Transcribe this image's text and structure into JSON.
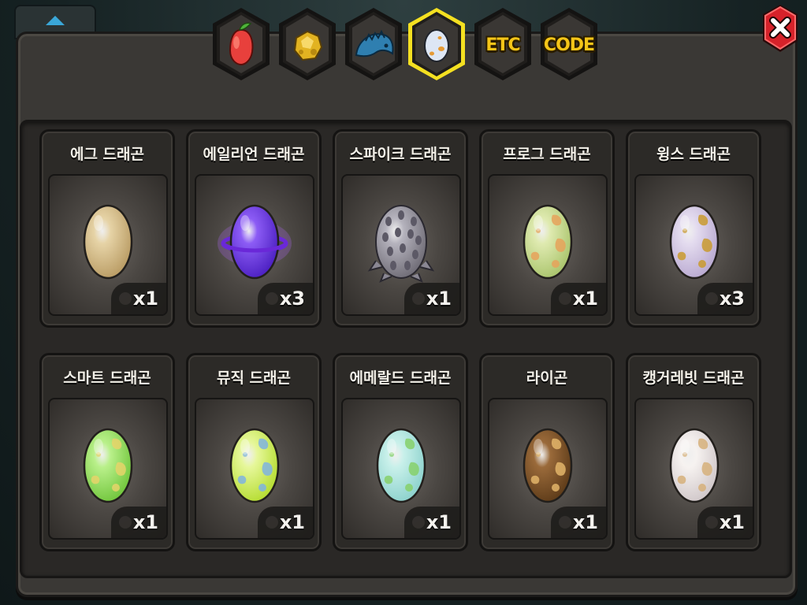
{
  "tabs": [
    {
      "id": "fruit",
      "icon": "red-fruit-icon",
      "label": "",
      "active": false
    },
    {
      "id": "gold",
      "icon": "gold-nugget-icon",
      "label": "",
      "active": false
    },
    {
      "id": "fossil",
      "icon": "blue-dragon-head-icon",
      "label": "",
      "active": false
    },
    {
      "id": "egg",
      "icon": "egg-icon",
      "label": "",
      "active": true
    },
    {
      "id": "etc",
      "icon": "",
      "label": "ETC",
      "active": false
    },
    {
      "id": "code",
      "icon": "",
      "label": "CODE",
      "active": false
    }
  ],
  "colors": {
    "active_tab_border": "#f4e021",
    "tab_face": "#3a3734",
    "label_yellow": "#f5c518",
    "close_red": "#d6222a"
  },
  "items": [
    {
      "name": "에그 드래곤",
      "qty": "x1",
      "egg": {
        "base": "#e6d3a6",
        "dark": "#b89a62",
        "spots": "none"
      }
    },
    {
      "name": "에일리언 드래곤",
      "qty": "x3",
      "egg": {
        "base": "#8c5cf5",
        "dark": "#4a1ec0",
        "spots": "ring"
      }
    },
    {
      "name": "스파이크 드래곤",
      "qty": "x1",
      "egg": {
        "base": "#b5b3bd",
        "dark": "#6d6a74",
        "spots": "spikes"
      }
    },
    {
      "name": "프로그 드래곤",
      "qty": "x1",
      "egg": {
        "base": "#dfeab0",
        "dark": "#a8c36a",
        "spots": "#e6a25a"
      }
    },
    {
      "name": "윙스 드래곤",
      "qty": "x3",
      "egg": {
        "base": "#e4dcef",
        "dark": "#b8a8d0",
        "spots": "#c99a2e"
      }
    },
    {
      "name": "스마트 드래곤",
      "qty": "x1",
      "egg": {
        "base": "#b9f08a",
        "dark": "#6fc43a",
        "spots": "#e6d36a"
      }
    },
    {
      "name": "뮤직 드래곤",
      "qty": "x1",
      "egg": {
        "base": "#e6f79a",
        "dark": "#b4dc2e",
        "spots": "#7fb3e0"
      }
    },
    {
      "name": "에메랄드 드래곤",
      "qty": "x1",
      "egg": {
        "base": "#c8f0ea",
        "dark": "#8bd1cc",
        "spots": "#86d06a"
      }
    },
    {
      "name": "라이곤",
      "qty": "x1",
      "egg": {
        "base": "#9a6a3a",
        "dark": "#5c3a18",
        "spots": "#e3b56a"
      }
    },
    {
      "name": "캥거레빗 드래곤",
      "qty": "x1",
      "egg": {
        "base": "#f6f2f0",
        "dark": "#cfc6c8",
        "spots": "#d6b07a"
      }
    }
  ]
}
